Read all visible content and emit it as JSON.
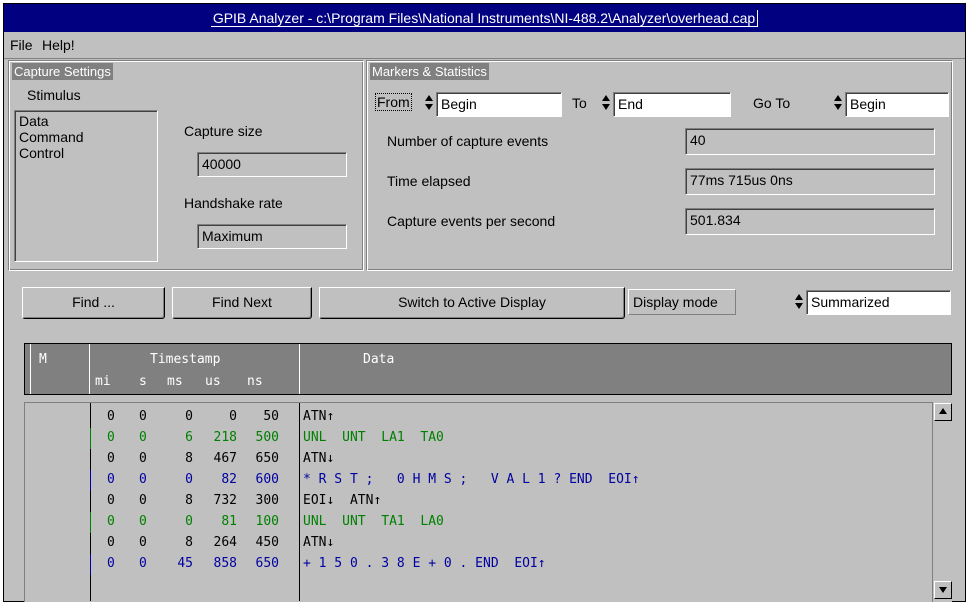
{
  "window": {
    "title": "GPIB Analyzer - c:\\Program Files\\National Instruments\\NI-488.2\\Analyzer\\overhead.cap"
  },
  "menu": {
    "file": "File",
    "help": "Help!"
  },
  "capture_settings": {
    "title": "Capture Settings",
    "stimulus_label": "Stimulus",
    "stimulus_items": [
      "Data",
      "Command",
      "Control"
    ],
    "capture_size_label": "Capture size",
    "capture_size_value": "40000",
    "handshake_rate_label": "Handshake rate",
    "handshake_rate_value": "Maximum"
  },
  "markers": {
    "title": "Markers & Statistics",
    "from_label": "From",
    "from_value": "Begin",
    "to_label": "To",
    "to_value": "End",
    "goto_label": "Go To",
    "goto_value": "Begin",
    "num_events_label": "Number of capture events",
    "num_events_value": "40",
    "time_elapsed_label": "Time elapsed",
    "time_elapsed_value": "77ms 715us  0ns",
    "events_per_sec_label": "Capture events per second",
    "events_per_sec_value": "501.834"
  },
  "toolbar": {
    "find_label": "Find ...",
    "find_next_label": "Find Next",
    "switch_label": "Switch to Active Display",
    "display_mode_label": "Display mode",
    "display_mode_value": "Summarized"
  },
  "table": {
    "header_m": "M",
    "header_timestamp": "Timestamp",
    "header_data": "Data",
    "sub_headers": [
      "mi",
      "s",
      "ms",
      "us",
      "ns"
    ],
    "rows": [
      {
        "mi": "0",
        "s": "0",
        "ms": "0",
        "us": "0",
        "ns": "50",
        "data": "ATN↑",
        "color": "#000000"
      },
      {
        "mi": "0",
        "s": "0",
        "ms": "6",
        "us": "218",
        "ns": "500",
        "data": "UNL  UNT  LA1  TA0",
        "color": "#008000"
      },
      {
        "mi": "0",
        "s": "0",
        "ms": "8",
        "us": "467",
        "ns": "650",
        "data": "ATN↓",
        "color": "#000000"
      },
      {
        "mi": "0",
        "s": "0",
        "ms": "0",
        "us": "82",
        "ns": "600",
        "data": "* R S T ;   0 H M S ;   V A L 1 ? END  EOI↑",
        "color": "#0000a0"
      },
      {
        "mi": "0",
        "s": "0",
        "ms": "8",
        "us": "732",
        "ns": "300",
        "data": "EOI↓  ATN↑",
        "color": "#000000"
      },
      {
        "mi": "0",
        "s": "0",
        "ms": "0",
        "us": "81",
        "ns": "100",
        "data": "UNL  UNT  TA1  LA0",
        "color": "#008000"
      },
      {
        "mi": "0",
        "s": "0",
        "ms": "8",
        "us": "264",
        "ns": "450",
        "data": "ATN↓",
        "color": "#000000"
      },
      {
        "mi": "0",
        "s": "0",
        "ms": "45",
        "us": "858",
        "ns": "650",
        "data": "+ 1 5 0 . 3 8 E + 0 . END  EOI↑",
        "color": "#0000a0"
      }
    ]
  },
  "icons": {
    "spinner": "spinner-icon",
    "scroll_up": "scroll-up-arrow-icon",
    "scroll_down": "scroll-down-arrow-icon"
  }
}
